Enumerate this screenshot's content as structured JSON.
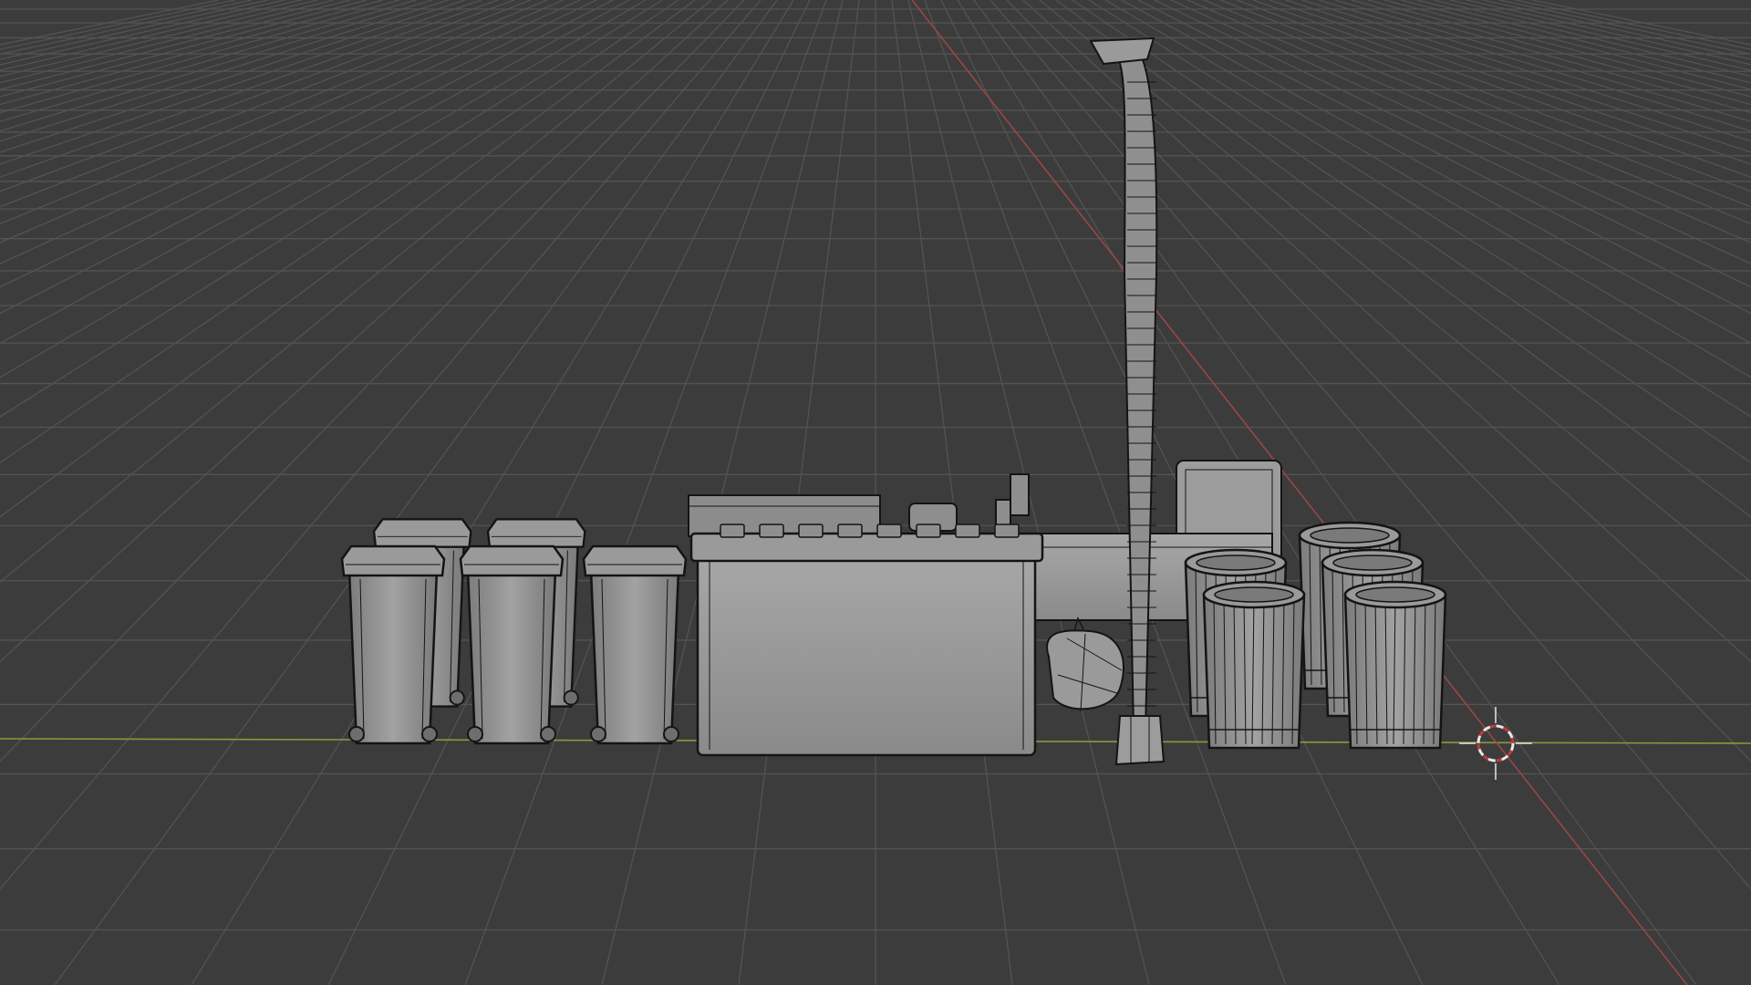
{
  "viewport": {
    "background": "#3c3c3c",
    "grid_color": "#535353",
    "x_axis_color": "#8a9a3c",
    "y_axis_color": "#9a4646",
    "mesh_fill": "#8e8e8e",
    "mesh_fill_light": "#a6a6a6",
    "wire_color": "#141414"
  },
  "scene": {
    "wheelie_bin_count": 6,
    "dumpster_count": 1,
    "street_lamp_count": 1,
    "trash_bag_count": 1,
    "metal_can_count": 6,
    "crate_count": 1
  },
  "cursor_icon": "3d-cursor-icon"
}
